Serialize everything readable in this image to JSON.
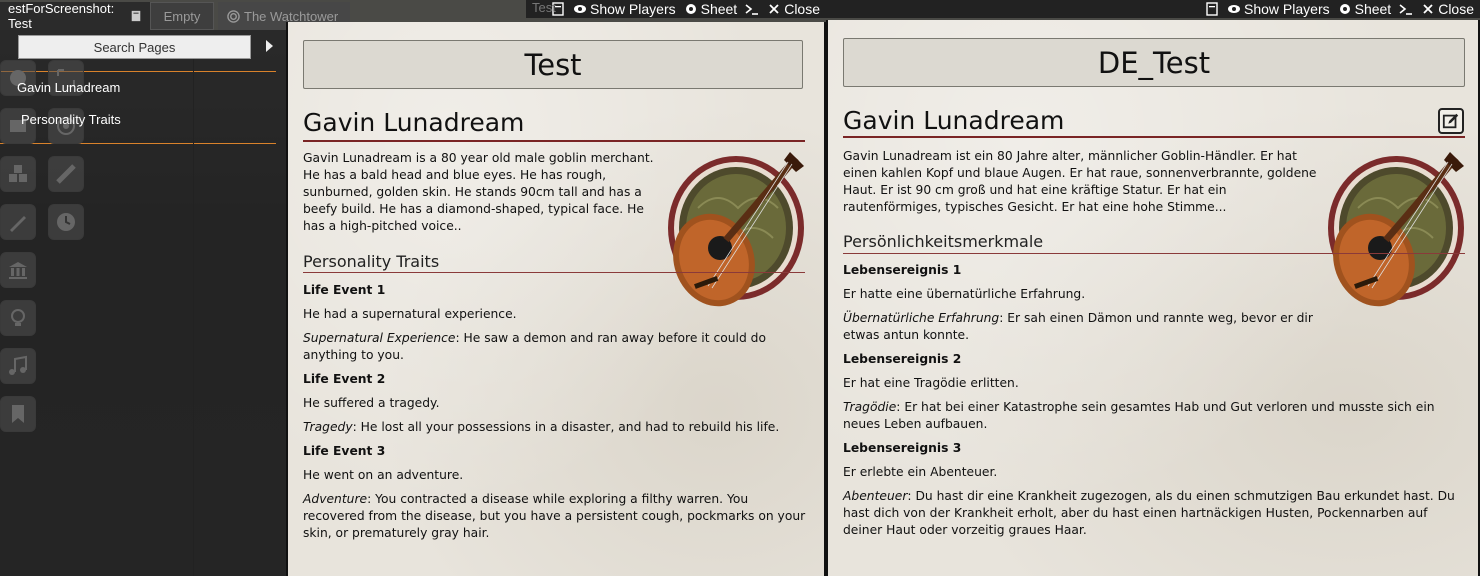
{
  "scene_tabs": {
    "active": "estForScreenshot: Test",
    "empty": "Empty",
    "watchtower": "The Watchtower"
  },
  "sidebar": {
    "search_label": "Search Pages",
    "entry_name": "Gavin Lunadream",
    "entry_section": "Personality Traits"
  },
  "window_left": {
    "title": "Test",
    "header": {
      "show_players": "Show Players",
      "sheet": "Sheet",
      "close": "Close"
    },
    "page_name": "Test",
    "character_name": "Gavin Lunadream",
    "description": "Gavin Lunadream is a 80 year old male goblin merchant. He has a bald head and blue eyes. He has rough, sunburned, golden skin. He stands 90cm tall and has a beefy build. He has a diamond-shaped, typical face. He has a high-pitched voice..",
    "traits_heading": "Personality Traits",
    "events": [
      {
        "title": "Life Event 1",
        "summary": "He had a supernatural experience.",
        "detail_label": "Supernatural Experience",
        "detail_text": ": He saw a demon and ran away before it could do anything to you."
      },
      {
        "title": "Life Event 2",
        "summary": "He suffered a tragedy.",
        "detail_label": "Tragedy",
        "detail_text": ": He lost all your possessions in a disaster, and had to rebuild his life."
      },
      {
        "title": "Life Event 3",
        "summary": "He went on an adventure.",
        "detail_label": "Adventure",
        "detail_text": ": You contracted a disease while exploring a filthy warren. You recovered from the disease, but you have a persistent cough, pockmarks on your skin, or prematurely gray hair."
      }
    ]
  },
  "window_right": {
    "header": {
      "show_players": "Show Players",
      "sheet": "Sheet",
      "close": "Close"
    },
    "page_name": "DE_Test",
    "character_name": "Gavin Lunadream",
    "description": "Gavin Lunadream ist ein 80 Jahre alter, männlicher Goblin-Händler. Er hat einen kahlen Kopf und blaue Augen. Er hat raue, sonnenverbrannte, goldene Haut. Er ist 90 cm groß und hat eine kräftige Statur. Er hat ein rautenförmiges, typisches Gesicht. Er hat eine hohe Stimme...",
    "traits_heading": "Persönlichkeitsmerkmale",
    "events": [
      {
        "title": "Lebensereignis 1",
        "summary": "Er hatte eine übernatürliche Erfahrung.",
        "detail_label": "Übernatürliche Erfahrung",
        "detail_text": ": Er sah einen Dämon und rannte weg, bevor er dir etwas antun konnte."
      },
      {
        "title": "Lebensereignis 2",
        "summary": "Er hat eine Tragödie erlitten.",
        "detail_label": "Tragödie",
        "detail_text": ": Er hat bei einer Katastrophe sein gesamtes Hab und Gut verloren und musste sich ein neues Leben aufbauen."
      },
      {
        "title": "Lebensereignis 3",
        "summary": "Er erlebte ein Abenteuer.",
        "detail_label": "Abenteuer",
        "detail_text": ": Du hast dir eine Krankheit zugezogen, als du einen schmutzigen Bau erkundet hast. Du hast dich von der Krankheit erholt, aber du hast einen hartnäckigen Husten, Pockennarben auf deiner Haut oder vorzeitig graues Haar."
      }
    ]
  },
  "colors": {
    "heading_rule": "#7a2525",
    "parchment": "#e8e4dc",
    "sidebar_divider": "#d9822b"
  },
  "icons": [
    "book-icon",
    "eye-icon",
    "gear-icon",
    "terminal-icon",
    "close-icon",
    "edit-icon",
    "lute-icon"
  ]
}
